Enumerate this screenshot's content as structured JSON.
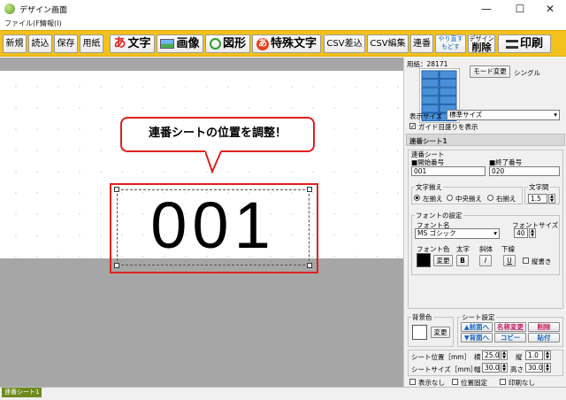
{
  "window": {
    "title": "デザイン画面",
    "minimize": "—",
    "maximize": "☐",
    "close": "✕"
  },
  "menu": [
    "ファイル(F)",
    "情報(I)"
  ],
  "toolbar": {
    "new": "新規",
    "load": "読込",
    "save": "保存",
    "paper": "用紙",
    "text": "文字",
    "text_icon": "あ",
    "image": "画像",
    "shape": "図形",
    "special_text": "特殊文字",
    "special_icon": "あ",
    "csv_insert": "CSV差込",
    "csv_edit": "CSV編集",
    "serial": "連番",
    "redo": "やり直す",
    "undo": "もどす",
    "design_delete_top": "デザイン",
    "design_delete": "削除",
    "print": "印刷"
  },
  "canvas": {
    "callout": "連番シートの位置を調整！",
    "serial_text": "001"
  },
  "statusbar": {
    "tab": "連番シート1"
  },
  "panel": {
    "paper_label": "用紙：28171",
    "mode_change": "モード変更",
    "mode": "シングル",
    "display_size_label": "表示サイズ",
    "display_size_value": "標準サイズ",
    "guide_label": "ガイド目盛りを表示",
    "guide_checked": true,
    "section_title": "連番シート1",
    "serial_group": "連番シート",
    "start_label": "■開始番号",
    "start_value": "001",
    "end_label": "■終了番号",
    "end_value": "020",
    "align_label": "文字揃え",
    "align_left": "左揃え",
    "align_center": "中央揃え",
    "align_right": "右揃え",
    "spacing_label": "文字間",
    "spacing_value": "1.5",
    "font_group": "フォントの設定",
    "font_name_label": "フォント名",
    "font_name_value": "MS ゴシック",
    "font_size_label": "フォントサイズ",
    "font_size_value": "40",
    "font_color_label": "フォント色",
    "bold_label": "太字",
    "italic_label": "斜体",
    "underline_label": "下線",
    "change": "変更",
    "bold": "B",
    "italic": "I",
    "underline": "U",
    "vertical": "縦書き",
    "bg_label": "背景色",
    "bg_change": "変更",
    "sheet_settings": "シート設定",
    "front": "▲前面へ",
    "back": "▼背面へ",
    "name_change": "名称変更",
    "copy": "コピー",
    "delete": "削除",
    "paste": "貼付",
    "pos_label": "シート位置［mm］",
    "x_label": "横",
    "x_value": "25.0",
    "y_label": "縦",
    "y_value": "1.0",
    "size_label": "シートサイズ［mm］",
    "w_label": "幅",
    "w_value": "30.0",
    "h_label": "高さ",
    "h_value": "30.0",
    "hide": "表示なし",
    "fix_pos": "位置固定",
    "no_print": "印刷なし",
    "accent_color": "#c2185b",
    "blue_text": "#1565c0"
  }
}
